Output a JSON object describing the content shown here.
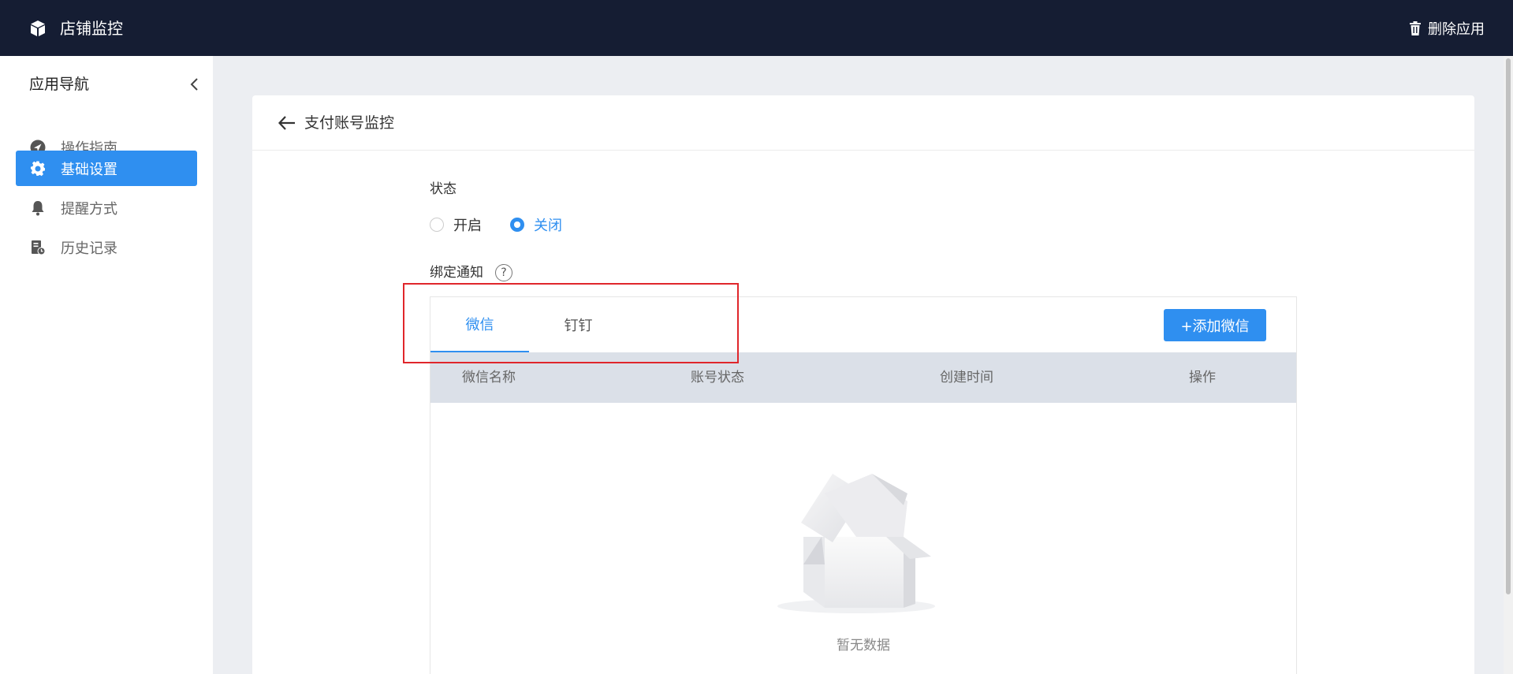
{
  "topbar": {
    "app_title": "店铺监控",
    "delete_label": "删除应用"
  },
  "sidebar": {
    "title": "应用导航",
    "items": [
      {
        "label": "操作指南",
        "icon": "compass-icon"
      },
      {
        "label": "基础设置",
        "icon": "gear-icon",
        "active": true
      },
      {
        "label": "提醒方式",
        "icon": "bell-icon"
      },
      {
        "label": "历史记录",
        "icon": "history-icon"
      }
    ]
  },
  "page": {
    "title": "支付账号监控",
    "status_label": "状态",
    "status_options": [
      "开启",
      "关闭"
    ],
    "status_selected": "关闭",
    "bind_label": "绑定通知"
  },
  "panel": {
    "tabs": [
      "微信",
      "钉钉"
    ],
    "active_tab": "微信",
    "add_button": "+添加微信",
    "columns": [
      "微信名称",
      "账号状态",
      "创建时间",
      "操作"
    ],
    "rows": [],
    "empty_text": "暂无数据"
  },
  "colors": {
    "accent": "#2f8ff0",
    "topbar_bg": "#151d33",
    "highlight": "#e0262b"
  }
}
